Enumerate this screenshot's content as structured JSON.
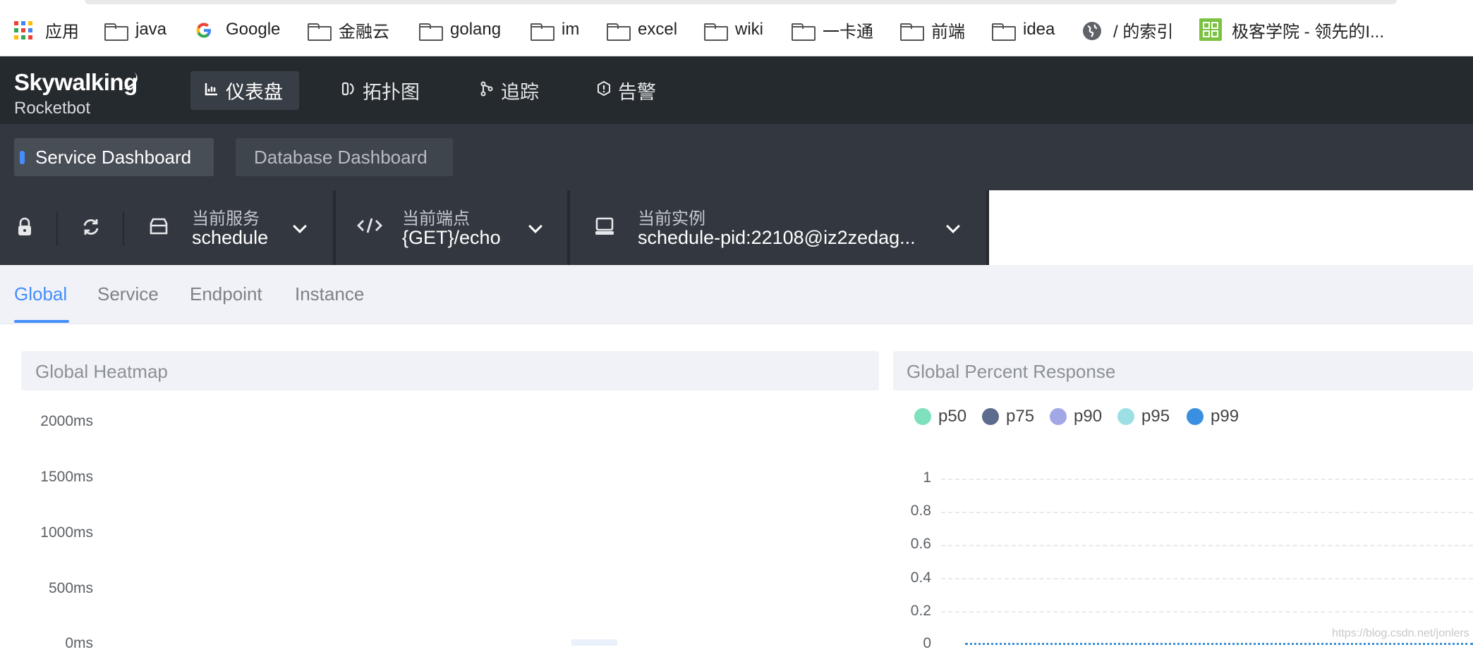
{
  "bookmarks": [
    {
      "label": "应用",
      "icon": "apps-grid-icon"
    },
    {
      "label": "java",
      "icon": "folder-icon"
    },
    {
      "label": "Google",
      "icon": "google-icon"
    },
    {
      "label": "金融云",
      "icon": "folder-icon"
    },
    {
      "label": "golang",
      "icon": "folder-icon"
    },
    {
      "label": "im",
      "icon": "folder-icon"
    },
    {
      "label": "excel",
      "icon": "folder-icon"
    },
    {
      "label": "wiki",
      "icon": "folder-icon"
    },
    {
      "label": "一卡通",
      "icon": "folder-icon"
    },
    {
      "label": "前端",
      "icon": "folder-icon"
    },
    {
      "label": "idea",
      "icon": "folder-icon"
    },
    {
      "label": "/ 的索引",
      "icon": "globe-icon"
    },
    {
      "label": "极客学院 - 领先的I...",
      "icon": "jikexueyuan-icon"
    }
  ],
  "logo": {
    "top": "Skywalking",
    "bottom": "Rocketbot"
  },
  "nav": [
    {
      "label": "仪表盘",
      "icon": "chart-icon",
      "active": true
    },
    {
      "label": "拓扑图",
      "icon": "topology-icon",
      "active": false
    },
    {
      "label": "追踪",
      "icon": "trace-icon",
      "active": false
    },
    {
      "label": "告警",
      "icon": "alarm-icon",
      "active": false
    }
  ],
  "dashboards": {
    "active": "Service Dashboard",
    "inactive": "Database Dashboard"
  },
  "selectors": {
    "service": {
      "label": "当前服务",
      "value": "schedule"
    },
    "endpoint": {
      "label": "当前端点",
      "value": "{GET}/echo"
    },
    "instance": {
      "label": "当前实例",
      "value": "schedule-pid:22108@iz2zedag..."
    }
  },
  "tabs": [
    "Global",
    "Service",
    "Endpoint",
    "Instance"
  ],
  "heatmap": {
    "title": "Global Heatmap",
    "y_labels": [
      "2000ms",
      "1500ms",
      "1000ms",
      "500ms",
      "0ms"
    ]
  },
  "percent_response": {
    "title": "Global Percent Response",
    "legend": [
      {
        "name": "p50",
        "color": "#7ee0bc"
      },
      {
        "name": "p75",
        "color": "#5d6b8e"
      },
      {
        "name": "p90",
        "color": "#a2a7e6"
      },
      {
        "name": "p95",
        "color": "#9de0e3"
      },
      {
        "name": "p99",
        "color": "#3a8fe0"
      }
    ],
    "y_ticks": [
      "1",
      "0.8",
      "0.6",
      "0.4",
      "0.2",
      "0"
    ]
  },
  "watermark": "https://blog.csdn.net/jonlers",
  "colors": {
    "accent": "#448dfe",
    "header": "#252a2f",
    "toolbar": "#333840"
  }
}
